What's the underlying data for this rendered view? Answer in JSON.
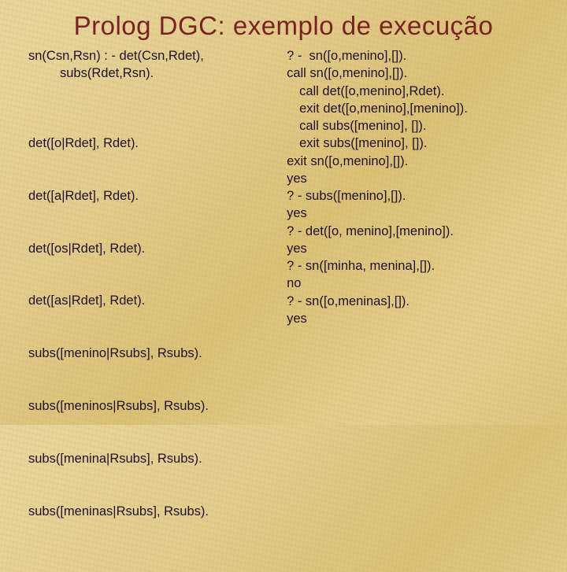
{
  "title": "Prolog DGC: exemplo de execução",
  "left": {
    "rule1a": "sn(Csn,Rsn) : - det(Csn,Rdet),",
    "rule1b": "subs(Rdet,Rsn).",
    "facts": [
      "det([o|Rdet], Rdet).",
      "det([a|Rdet], Rdet).",
      "det([os|Rdet], Rdet).",
      "det([as|Rdet], Rdet).",
      "subs([menino|Rsubs], Rsubs).",
      "subs([meninos|Rsubs], Rsubs).",
      "subs([menina|Rsubs], Rsubs).",
      "subs([meninas|Rsubs], Rsubs)."
    ]
  },
  "right": {
    "lines": [
      {
        "t": "? -  sn([o,menino],[]).",
        "i": 0
      },
      {
        "t": "call sn([o,menino],[]).",
        "i": 0
      },
      {
        "t": "call det([o,menino],Rdet).",
        "i": 1
      },
      {
        "t": "exit det([o,menino],[menino]).",
        "i": 1
      },
      {
        "t": "call subs([menino], []).",
        "i": 1
      },
      {
        "t": "exit subs([menino], []).",
        "i": 1
      },
      {
        "t": "exit sn([o,menino],[]).",
        "i": 0
      },
      {
        "t": "yes",
        "i": 0
      },
      {
        "t": "? - subs([menino],[]).",
        "i": 0
      },
      {
        "t": "yes",
        "i": 0
      },
      {
        "t": "? - det([o, menino],[menino]).",
        "i": 0
      },
      {
        "t": "yes",
        "i": 0
      },
      {
        "t": "? - sn([minha, menina],[]).",
        "i": 0
      },
      {
        "t": "no",
        "i": 0
      },
      {
        "t": "? - sn([o,meninas],[]).",
        "i": 0
      },
      {
        "t": "yes",
        "i": 0
      }
    ]
  }
}
